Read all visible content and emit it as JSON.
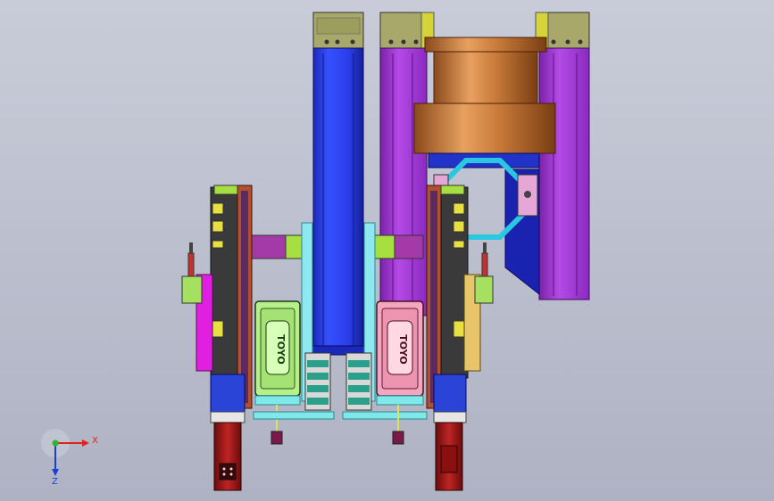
{
  "viewport": {
    "background_top": "#c9ccd8",
    "background_bottom": "#aeb2c3"
  },
  "triad": {
    "x_label": "X",
    "z_label": "Z",
    "x_color": "#e0231c",
    "y_color": "#2fb52f",
    "z_color": "#1a3fd6"
  },
  "components": {
    "left_motor_label": "TOYO",
    "right_motor_label": "TOYO",
    "copper_cylinder_color": "#c87a3a",
    "blue_column_color": "#2a3ee8",
    "purple_frame_color": "#a53ad6",
    "olive_bracket_color": "#a8a86a",
    "green_motor_color": "#b7ef8a",
    "pink_motor_color": "#f2a6c0",
    "dark_red_motor_color": "#a01818",
    "cyan_plate_color": "#7fe9e9",
    "magenta_color": "#e01fe0"
  }
}
